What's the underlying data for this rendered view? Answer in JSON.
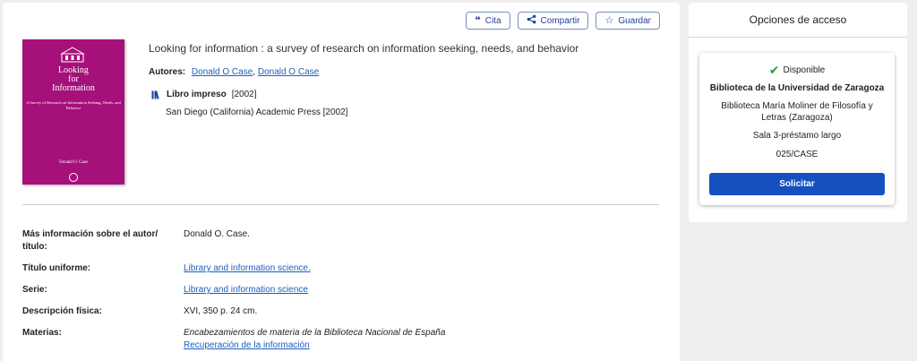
{
  "toolbar": {
    "cite_label": "Cita",
    "cite_icon": "quote-icon",
    "share_label": "Compartir",
    "share_icon": "share-icon",
    "save_label": "Guardar",
    "save_icon": "star-icon"
  },
  "cover": {
    "title_line1": "Looking",
    "title_line2": "for",
    "title_line3": "Information",
    "subtitle": "A Survey of Research on Information Seeking, Needs, and Behavior",
    "author": "Donald O. Case",
    "color": "#a5107a"
  },
  "record": {
    "title": "Looking for information : a survey of research on information seeking, needs, and behavior",
    "authors_label": "Autores:",
    "authors": [
      "Donald O Case",
      "Donald O Case"
    ],
    "format_icon": "books-icon",
    "format_label": "Libro impreso",
    "format_year": "[2002]",
    "publisher": "San Diego (California) Academic Press [2002]"
  },
  "details": [
    {
      "key": "Más información sobre el autor/ título:",
      "value": "Donald O. Case."
    },
    {
      "key": "Título uniforme:",
      "value": "Library and information science."
    },
    {
      "key": "Serie:",
      "value": "Library and information science"
    },
    {
      "key": "Descripción física:",
      "value": "XVI, 350 p. 24 cm."
    },
    {
      "key": "Materias:",
      "value_italic": "Encabezamientos de materia de la Biblioteca Nacional de España",
      "value": "Recuperación de la información"
    }
  ],
  "access": {
    "title": "Opciones de acceso",
    "status": "Disponible",
    "status_icon": "check-icon",
    "status_color": "#2e9e3e",
    "library": "Biblioteca de la Universidad de Zaragoza",
    "branch": "Biblioteca María Moliner de Filosofía y Letras (Zaragoza)",
    "location": "Sala 3-préstamo largo",
    "call_number": "025/CASE",
    "request_label": "Solicitar",
    "accent": "#1550c0"
  }
}
